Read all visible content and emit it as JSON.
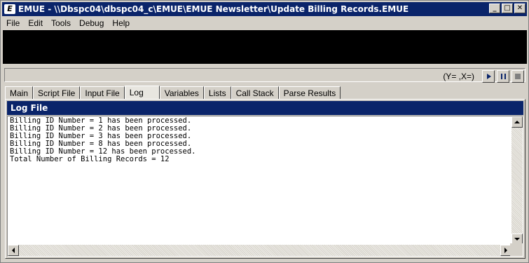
{
  "window": {
    "title": "EMUE - \\\\Dbspc04\\dbspc04_c\\EMUE\\EMUE Newsletter\\Update Billing Records.EMUE",
    "app_icon_text": "E",
    "min_glyph": "_",
    "max_glyph": "□",
    "close_glyph": "✕"
  },
  "menu": {
    "items": [
      "File",
      "Edit",
      "Tools",
      "Debug",
      "Help"
    ]
  },
  "controls": {
    "coords": "(Y= ,X=)"
  },
  "tabs": [
    "Main",
    "Script File",
    "Input File",
    "Log",
    "Variables",
    "Lists",
    "Call Stack",
    "Parse Results"
  ],
  "active_tab": "Log",
  "panel": {
    "title": "Log File",
    "log_text": "Billing ID Number = 1 has been processed.\nBilling ID Number = 2 has been processed.\nBilling ID Number = 3 has been processed.\nBilling ID Number = 8 has been processed.\nBilling ID Number = 12 has been processed.\nTotal Number of Billing Records = 12"
  },
  "colors": {
    "titlebar": "#0a246a",
    "panel_header": "#0a246a",
    "face": "#d4d0c8"
  },
  "icons": {
    "play": "play-icon",
    "pause": "pause-icon",
    "stop": "stop-icon"
  }
}
